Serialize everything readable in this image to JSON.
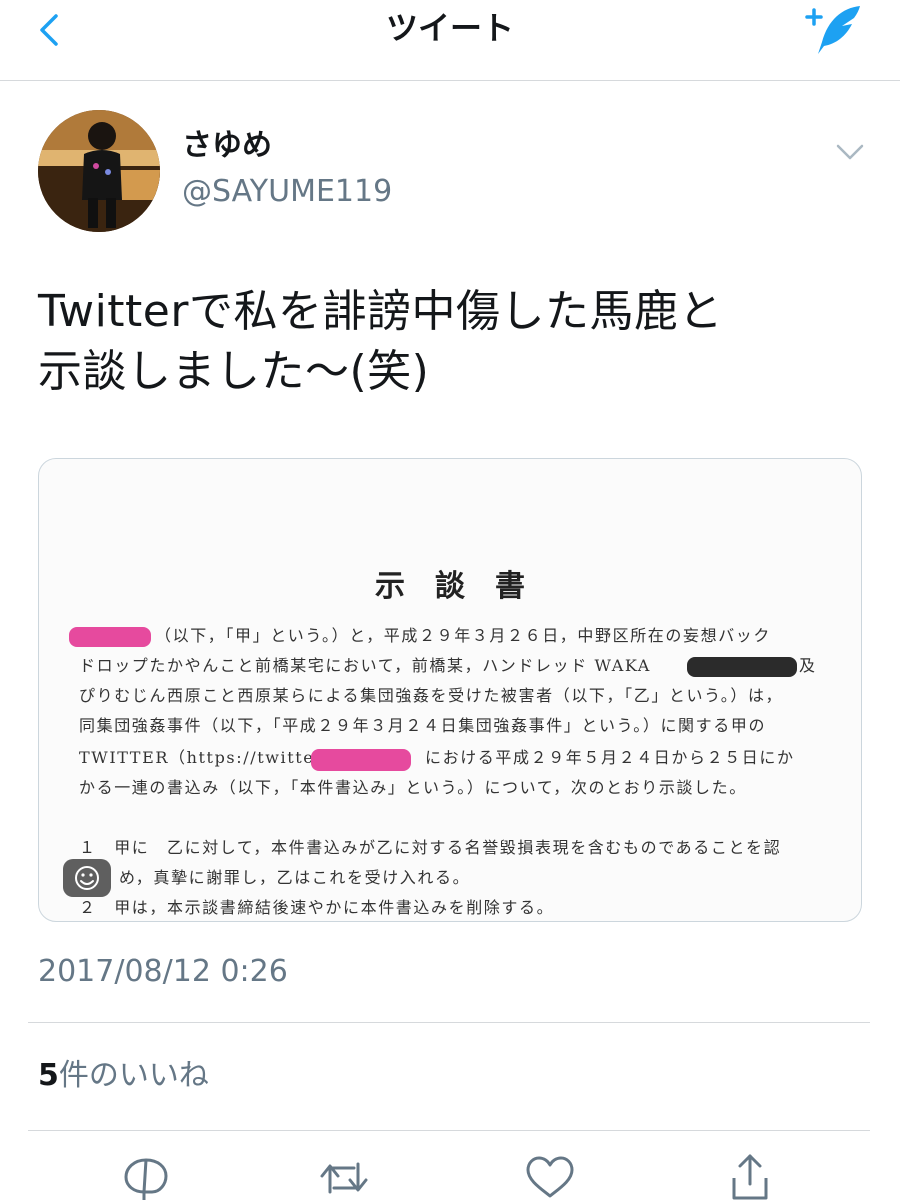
{
  "header": {
    "title": "ツイート",
    "back_icon": "chevron-left-icon",
    "compose_icon": "compose-tweet-icon"
  },
  "author": {
    "display_name": "さゆめ",
    "handle": "@SAYUME119"
  },
  "tweet": {
    "text_line1": "Twitterで私を誹謗中傷した馬鹿と",
    "text_line2": "示談しました〜(笑)",
    "timestamp": "2017/08/12 0:26"
  },
  "document": {
    "title": "示談書",
    "lines": [
      "（以下，「甲」という。）と，平成２９年３月２６日，中野区所在の妄想バック",
      "ドロップたかやんこと前橋某宅において，前橋某，ハンドレッド WAKA",
      "ぴりむじん西原こと西原某らによる集団強姦を受けた被害者（以下，「乙」という。）は，",
      "同集団強姦事件（以下，「平成２９年３月２４日集団強姦事件」という。）に関する甲の",
      "TWITTER（https://twitter.com",
      "における平成２９年５月２４日から２５日にか",
      "かる一連の書込み（以下，「本件書込み」という。）について，次のとおり示談した。",
      "１　甲に　乙に対して，本件書込みが乙に対する名誉毀損表現を含むものであることを認",
      "め，真摯に謝罪し，乙はこれを受け入れる。",
      "２　甲は，本示談書締結後速やかに本件書込みを削除する。"
    ],
    "line2_suffix": "及"
  },
  "engagement": {
    "likes_count": "5",
    "likes_label": "件のいいね"
  },
  "actions": [
    "reply-icon",
    "retweet-icon",
    "like-icon",
    "share-icon"
  ],
  "colors": {
    "accent": "#1da1f2",
    "secondary_text": "#657786",
    "divider": "#d6d9dc",
    "redaction_pink": "#e64a9e"
  }
}
